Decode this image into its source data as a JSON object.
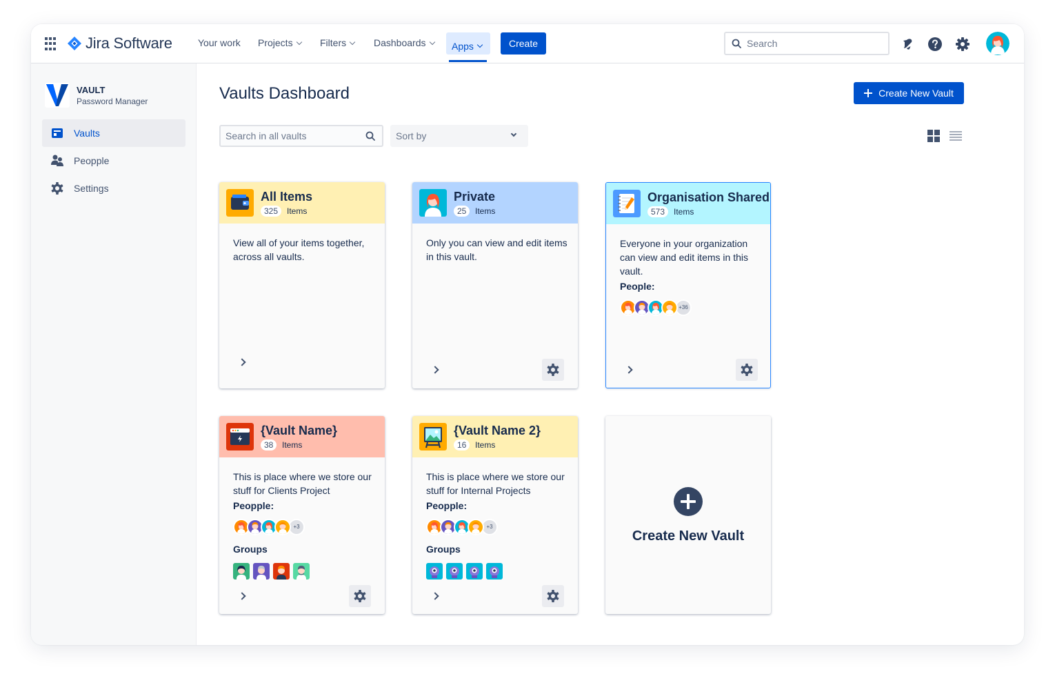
{
  "topnav": {
    "product": "Jira Software",
    "items": [
      {
        "label": "Your work"
      },
      {
        "label": "Projects"
      },
      {
        "label": "Filters"
      },
      {
        "label": "Dashboards"
      },
      {
        "label": "Apps"
      }
    ],
    "create_label": "Create",
    "search_placeholder": "Search"
  },
  "sidebar": {
    "app_title": "VAULT",
    "app_subtitle": "Password Manager",
    "items": [
      {
        "label": "Vaults",
        "icon": "vault-icon",
        "active": true
      },
      {
        "label": "Peopple",
        "icon": "people-icon",
        "active": false
      },
      {
        "label": "Settings",
        "icon": "gear-icon",
        "active": false
      }
    ]
  },
  "main": {
    "title": "Vaults Dashboard",
    "new_vault_label": "Create New Vault",
    "search_placeholder": "Search in all vaults",
    "sort_placeholder": "Sort by"
  },
  "cards": [
    {
      "title": "All Items",
      "count": "325",
      "items_label": "Items",
      "desc": "View all of your items together, across all vaults.",
      "header_color": "#fff0b3",
      "icon": "wallet-icon"
    },
    {
      "title": "Private",
      "count": "25",
      "items_label": "Items",
      "desc": "Only you can view and edit items in this vault.",
      "header_color": "#b3d4ff",
      "icon": "avatar-icon"
    },
    {
      "title": "Organisation Shared",
      "count": "573",
      "items_label": "Items",
      "desc": "Everyone in your organization can view and edit items in this vault.",
      "people_label": "People:",
      "people_more": "+36",
      "header_color": "#b3f5ff",
      "icon": "notepad-icon"
    },
    {
      "title": "{Vault Name}",
      "count": "38",
      "items_label": "Items",
      "desc": "This is place where we store our stuff for Clients Project",
      "people_label": "Peopple:",
      "people_more": "+3",
      "groups_label": "Groups",
      "header_color": "#ffbdad",
      "icon": "browser-window-icon"
    },
    {
      "title": "{Vault Name 2}",
      "count": "16",
      "items_label": "Items",
      "desc": "This is place where we store our stuff for Internal Projects",
      "people_label": "Peopple:",
      "people_more": "+3",
      "groups_label": "Groups",
      "header_color": "#fff0b3",
      "icon": "easel-picture-icon"
    },
    {
      "new_label": "Create New Vault"
    }
  ],
  "colors": {
    "brand_blue": "#0052cc",
    "text_dark": "#172b4d",
    "selected_border": "#2684ff"
  }
}
